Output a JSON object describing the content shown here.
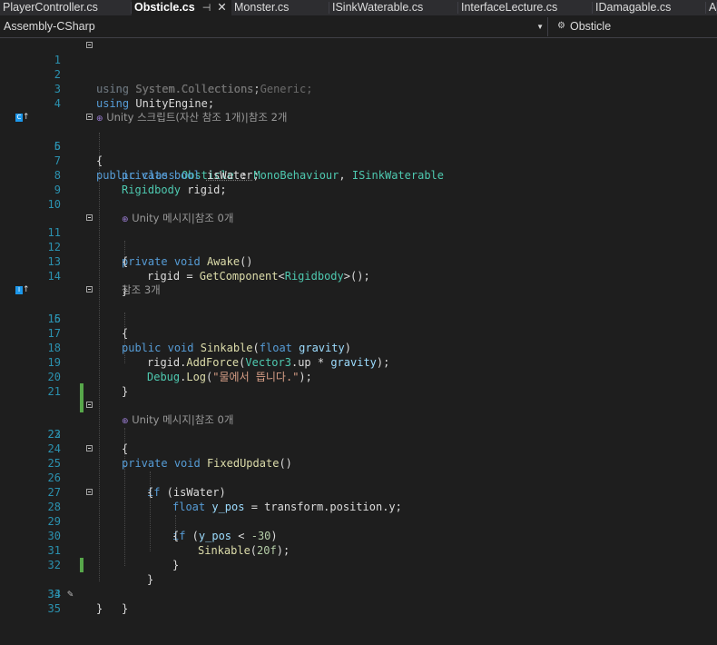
{
  "tabs": [
    {
      "label": "PlayerController.cs"
    },
    {
      "label": "Obsticle.cs",
      "pin": "⊣",
      "close": "✕"
    },
    {
      "label": "Monster.cs"
    },
    {
      "label": "ISinkWaterable.cs"
    },
    {
      "label": "InterfaceLecture.cs"
    },
    {
      "label": "IDamagable.cs"
    },
    {
      "label": "A"
    }
  ],
  "nav": {
    "project": "Assembly-CSharp",
    "class_name": "Obsticle"
  },
  "codelens": {
    "unity_script": "Unity 스크립트(자산 참조 1개)|참조 2개",
    "unity_message": "Unity 메시지|참조 0개",
    "refs3": "참조 3개"
  },
  "code": {
    "l1": [
      "using",
      " System.Collections;"
    ],
    "l2": [
      "using",
      " System.Collections.Generic;"
    ],
    "l3": [
      "using",
      " UnityEngine;"
    ],
    "l5": [
      "public",
      "class",
      "Obsticle",
      ":",
      "MonoBehaviour",
      ",",
      "ISinkWaterable"
    ],
    "l6": "{",
    "l7": [
      "private",
      "bool",
      "isWater",
      ";"
    ],
    "l8": [
      "Rigidbody",
      "rigid;"
    ],
    "l11": [
      "private",
      "void",
      "Awake",
      "()"
    ],
    "l12": "{",
    "l13": [
      "rigid = ",
      "GetComponent",
      "<",
      "Rigidbody",
      ">();"
    ],
    "l14": "}",
    "l15": [
      "public",
      "void",
      "Sinkable",
      "(",
      "float",
      "gravity",
      ")"
    ],
    "l16": "{",
    "l18": [
      "rigid.",
      "AddForce",
      "(",
      "Vector3",
      ".up * ",
      "gravity",
      ");"
    ],
    "l19": [
      "Debug",
      ".",
      "Log",
      "(",
      "\"물에서 뜹니다.\"",
      ");"
    ],
    "l20": "}",
    "l22": [
      "private",
      "void",
      "FixedUpdate",
      "()"
    ],
    "l23": "{",
    "l25": [
      "if",
      " (isWater)"
    ],
    "l26": "{",
    "l27": [
      "float",
      "y_pos",
      " = transform.position.y;"
    ],
    "l28": [
      "if",
      " (",
      "y_pos",
      " < ",
      "-30",
      ")"
    ],
    "l29": "{",
    "l30": [
      "Sinkable",
      "(",
      "20f",
      ");"
    ],
    "l31": "}",
    "l32": "}",
    "l33": "}",
    "l34": "}"
  },
  "line_numbers": [
    "1",
    "2",
    "3",
    "4",
    "5",
    "6",
    "7",
    "8",
    "9",
    "10",
    "11",
    "12",
    "13",
    "14",
    "15",
    "16",
    "17",
    "18",
    "19",
    "20",
    "21",
    "22",
    "23",
    "24",
    "25",
    "26",
    "27",
    "28",
    "29",
    "30",
    "31",
    "32",
    "33",
    "34",
    "35"
  ]
}
